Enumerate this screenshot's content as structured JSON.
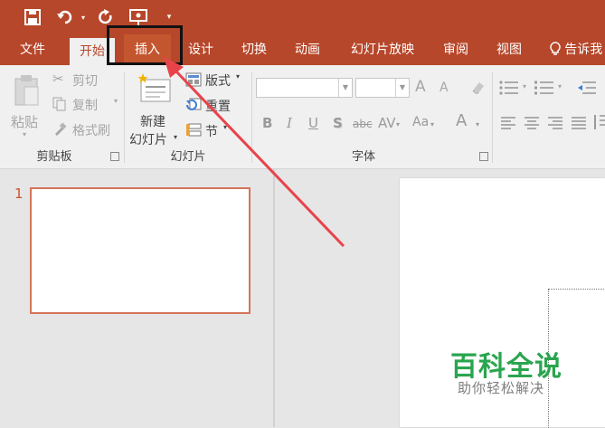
{
  "quick_access": {
    "icons": [
      "save-icon",
      "undo-icon",
      "redo-icon",
      "present-icon",
      "customize-icon"
    ]
  },
  "tabs": [
    {
      "label": "文件",
      "active": false
    },
    {
      "label": "开始",
      "active": true
    },
    {
      "label": "插入",
      "active": false,
      "highlighted": true
    },
    {
      "label": "设计",
      "active": false
    },
    {
      "label": "切换",
      "active": false
    },
    {
      "label": "动画",
      "active": false
    },
    {
      "label": "幻灯片放映",
      "active": false
    },
    {
      "label": "审阅",
      "active": false
    },
    {
      "label": "视图",
      "active": false
    },
    {
      "label": "告诉我",
      "active": false
    }
  ],
  "clipboard": {
    "paste": "粘贴",
    "cut": "剪切",
    "copy": "复制",
    "format_painter": "格式刷",
    "group_label": "剪贴板"
  },
  "slides": {
    "new_slide_line1": "新建",
    "new_slide_line2": "幻灯片",
    "layout": "版式",
    "reset": "重置",
    "section": "节",
    "group_label": "幻灯片"
  },
  "font": {
    "group_label": "字体",
    "font_name": "",
    "font_size": "",
    "bold": "B",
    "italic": "I",
    "underline": "U",
    "shadow": "S",
    "strike": "abc",
    "spacing": "AV",
    "case": "Aa",
    "grow": "A",
    "shrink": "A",
    "color": "A"
  },
  "slide_panel": {
    "slide_number": "1"
  },
  "watermark": {
    "title": "百科全说",
    "subtitle": "助你轻松解决"
  },
  "colors": {
    "accent": "#b7472a",
    "tab_highlight": "#c4562f",
    "thumb_border": "#d5755a",
    "annotation_arrow": "#e8434b",
    "watermark_green": "#2aa54f"
  }
}
